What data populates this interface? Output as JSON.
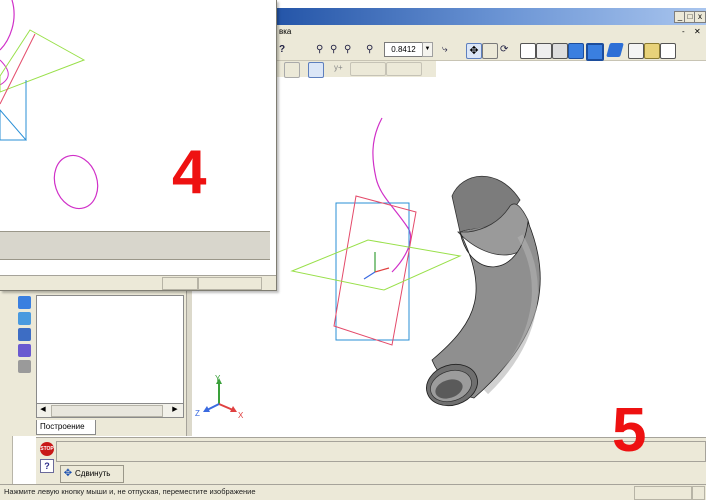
{
  "main_window": {
    "menu_fragment": "вка",
    "window_buttons": [
      "_",
      "□",
      "x"
    ],
    "mdi_buttons": [
      "-",
      "✕"
    ],
    "zoom_value": "0.8412"
  },
  "left_panel": {
    "tab_label": "Построение"
  },
  "property_bar": {
    "stop_label": "STOP",
    "help_label": "?",
    "shift_button_label": "Сдвинуть"
  },
  "status_bar": {
    "message": "Нажмите левую кнопку мыши и, не отпуская, переместите изображение"
  },
  "annotations": {
    "label_front_window": "4",
    "label_main_window": "5"
  },
  "axes": {
    "x": "X",
    "y": "Y",
    "z": "Z"
  },
  "colors": {
    "sketch_plane": "#2a8fd6",
    "front_plane": "#99e04a",
    "side_plane": "#e44a6a",
    "path_curve": "#d030c8",
    "pipe": "#8c8c8c",
    "annotation": "#ee1111"
  }
}
